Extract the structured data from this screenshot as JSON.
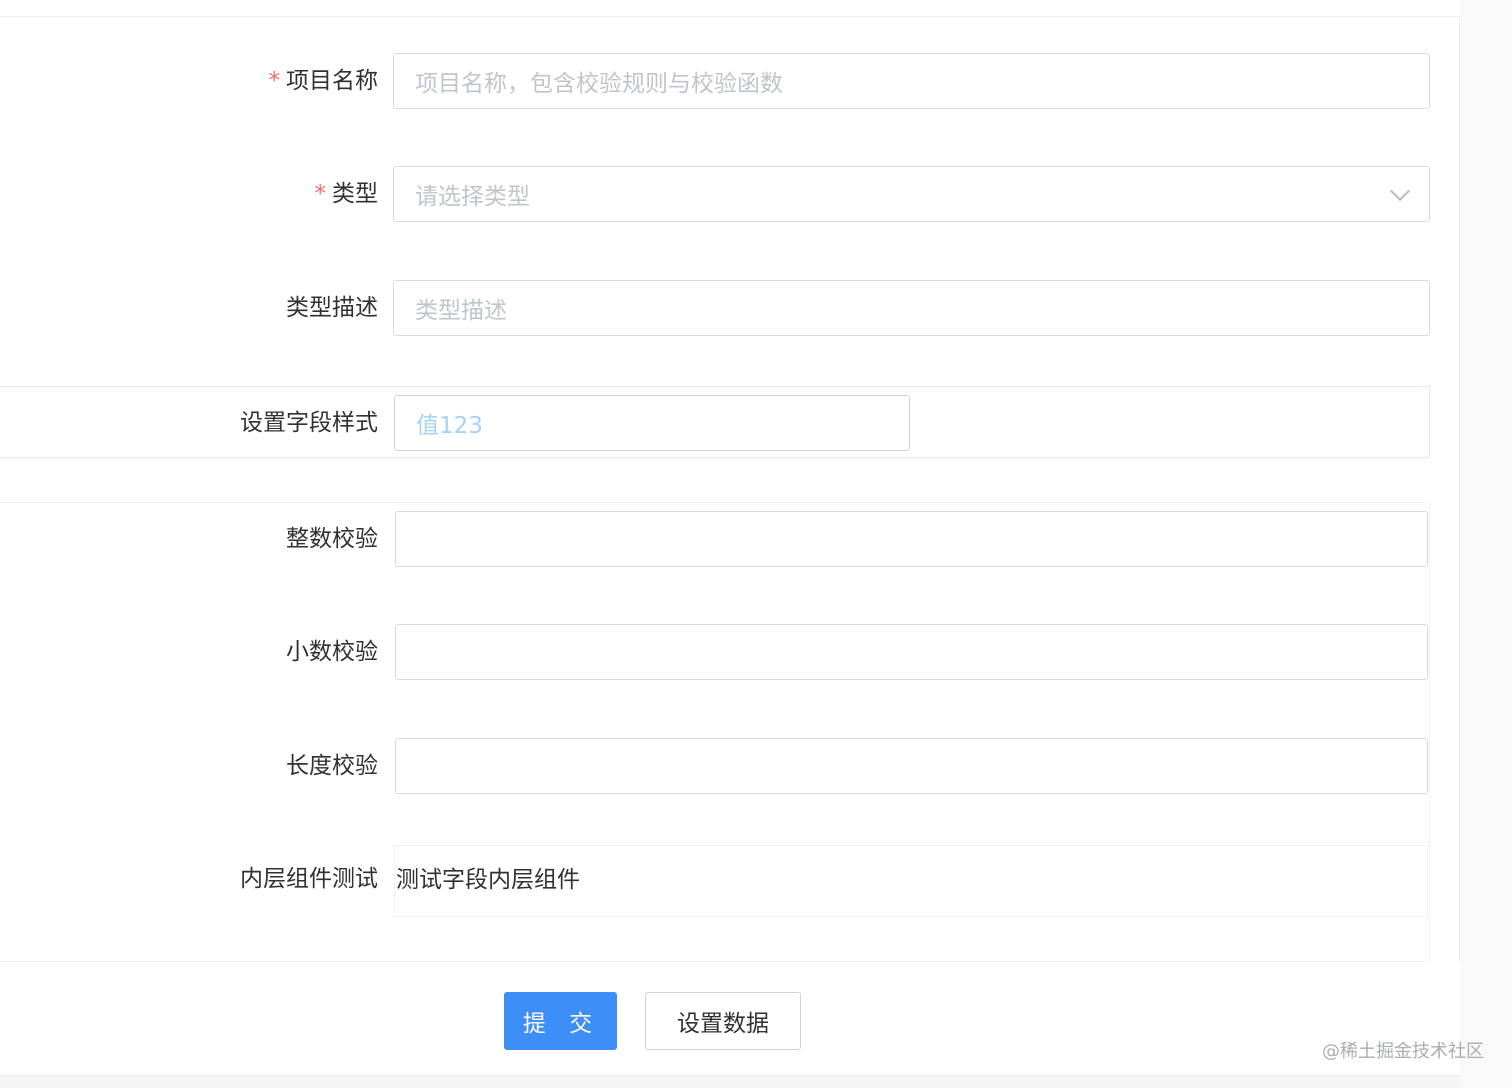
{
  "form": {
    "project_name": {
      "label": "项目名称",
      "required": true,
      "placeholder": "项目名称，包含校验规则与校验函数"
    },
    "type": {
      "label": "类型",
      "required": true,
      "placeholder": "请选择类型"
    },
    "type_desc": {
      "label": "类型描述",
      "placeholder": "类型描述"
    },
    "field_style": {
      "label": "设置字段样式",
      "value": "值123",
      "value_color": "#a6d2f5"
    },
    "integer_check": {
      "label": "整数校验",
      "value": ""
    },
    "decimal_check": {
      "label": "小数校验",
      "value": ""
    },
    "length_check": {
      "label": "长度校验",
      "value": ""
    },
    "inner_component": {
      "label": "内层组件测试",
      "text": "测试字段内层组件"
    }
  },
  "actions": {
    "submit_label": "提 交",
    "set_data_label": "设置数据"
  },
  "watermark": "@稀土掘金技术社区",
  "colors": {
    "primary": "#3d8ef7",
    "required": "#f56c6c",
    "border": "#d8dbe0",
    "placeholder": "#c0c4cc"
  }
}
